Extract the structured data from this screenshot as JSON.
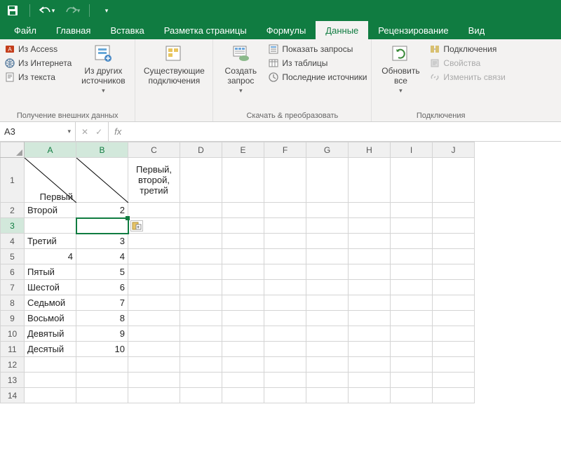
{
  "qat": {
    "save": "save-icon",
    "undo": "undo-icon",
    "redo": "redo-icon"
  },
  "tabs": [
    "Файл",
    "Главная",
    "Вставка",
    "Разметка страницы",
    "Формулы",
    "Данные",
    "Рецензирование",
    "Вид"
  ],
  "active_tab_index": 5,
  "ribbon": {
    "group1": {
      "items": [
        "Из Access",
        "Из Интернета",
        "Из текста"
      ],
      "big": "Из других источников",
      "label": "Получение внешних данных"
    },
    "group2": {
      "big": "Существующие подключения"
    },
    "group3": {
      "big": "Создать запрос",
      "items": [
        "Показать запросы",
        "Из таблицы",
        "Последние источники"
      ],
      "label": "Скачать & преобразовать"
    },
    "group4": {
      "big": "Обновить все",
      "items": [
        "Подключения",
        "Свойства",
        "Изменить связи"
      ],
      "label": "Подключения"
    }
  },
  "namebox": "A3",
  "fx_label": "fx",
  "formula": "",
  "columns": [
    "A",
    "B",
    "C",
    "D",
    "E",
    "F",
    "G",
    "H",
    "I",
    "J"
  ],
  "sel_cols": [
    "A",
    "B"
  ],
  "sel_row": 3,
  "cells": {
    "A1": "Первый",
    "C1": "Первый, второй, третий",
    "A2": "Второй",
    "B2": "2",
    "A4": "Третий",
    "B4": "3",
    "A5": "4",
    "B5": "4",
    "A6": "Пятый",
    "B6": "5",
    "A7": "Шестой",
    "B7": "6",
    "A8": "Седьмой",
    "B8": "7",
    "A9": "Восьмой",
    "B9": "8",
    "A10": "Девятый",
    "B10": "9",
    "A11": "Десятый",
    "B11": "10"
  },
  "row_count": 14
}
